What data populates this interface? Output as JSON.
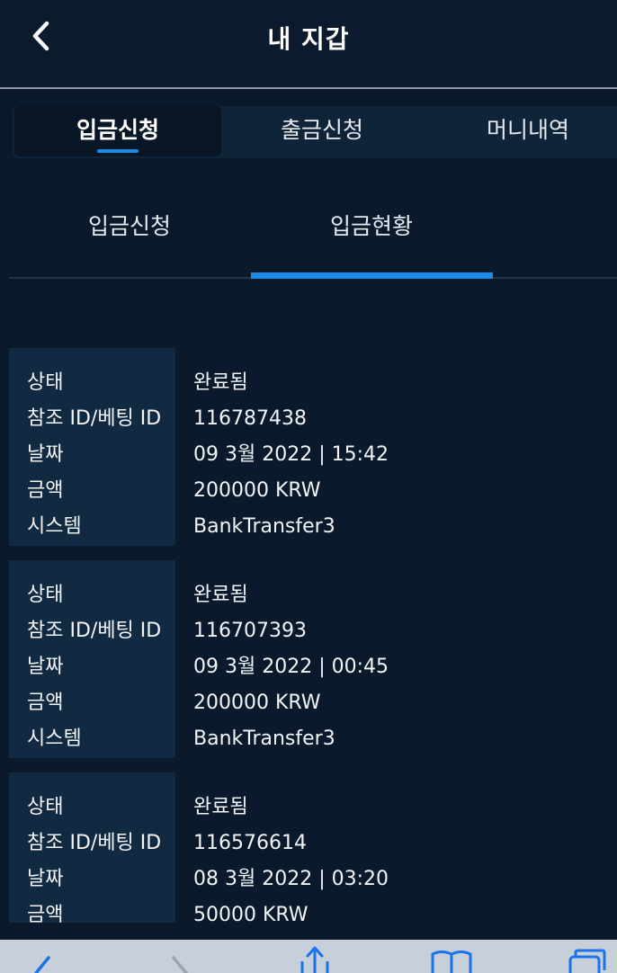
{
  "header": {
    "title": "내 지갑"
  },
  "tabs": [
    {
      "label": "입금신청"
    },
    {
      "label": "출금신청"
    },
    {
      "label": "머니내역"
    }
  ],
  "subtabs": [
    {
      "label": "입금신청"
    },
    {
      "label": "입금현황"
    }
  ],
  "labels": {
    "status": "상태",
    "ref": "참조 ID/베팅 ID",
    "date": "날짜",
    "amount": "금액",
    "system": "시스템"
  },
  "records": [
    {
      "status": "완료됨",
      "ref": "116787438",
      "date": "09 3월 2022 | 15:42",
      "amount": "200000 KRW",
      "system": "BankTransfer3"
    },
    {
      "status": "완료됨",
      "ref": "116707393",
      "date": "09 3월 2022 | 00:45",
      "amount": "200000 KRW",
      "system": "BankTransfer3"
    },
    {
      "status": "완료됨",
      "ref": "116576614",
      "date": "08 3월 2022 | 03:20",
      "amount": "50000 KRW",
      "system": ""
    }
  ],
  "colors": {
    "accent": "#1c8be8",
    "background": "#0a1a2c",
    "label_bg": "#112a42"
  },
  "icons": {
    "back": "chevron-left-icon",
    "browser": [
      "back-arrow-icon",
      "forward-arrow-icon",
      "share-icon",
      "bookmarks-icon",
      "tabs-icon"
    ]
  }
}
